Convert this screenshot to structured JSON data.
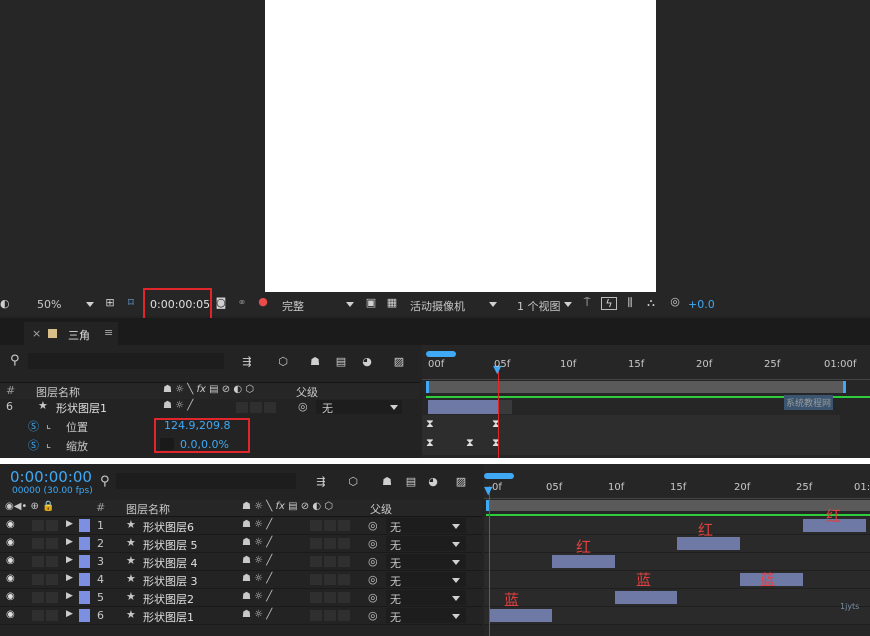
{
  "viewer": {
    "zoom": "50%",
    "timecode": "0:00:00:05",
    "resolution": "完整",
    "camera": "活动摄像机",
    "views": "1 个视图",
    "exposure": "+0.0"
  },
  "top_panel": {
    "close": "×",
    "tab_title": "三角",
    "menu": "≡",
    "search_icon": "⚲",
    "col_num": "#",
    "col_name": "图层名称",
    "col_parent": "父级",
    "layer_num": "6",
    "layer_name": "形状图层1",
    "parent_value": "无",
    "prop_position_label": "位置",
    "prop_position_value": "124.9,209.8",
    "prop_scale_label": "缩放",
    "prop_scale_value": "0.0,0.0%",
    "ruler": [
      "00f",
      "05f",
      "10f",
      "15f",
      "20f",
      "25f",
      "01:00f"
    ],
    "watermark": "系统教程网"
  },
  "bottom_panel": {
    "timecode": "0:00:00:00",
    "fps": "00000 (30.00 fps)",
    "col_num": "#",
    "col_name": "图层名称",
    "col_parent": "父级",
    "ruler": [
      "0f",
      "05f",
      "10f",
      "15f",
      "20f",
      "25f",
      "01:0"
    ],
    "layers": [
      {
        "num": "1",
        "name": "形状图层6",
        "parent": "无"
      },
      {
        "num": "2",
        "name": "形状图层 5",
        "parent": "无"
      },
      {
        "num": "3",
        "name": "形状图层 4",
        "parent": "无"
      },
      {
        "num": "4",
        "name": "形状图层 3",
        "parent": "无"
      },
      {
        "num": "5",
        "name": "形状图层2",
        "parent": "无"
      },
      {
        "num": "6",
        "name": "形状图层1",
        "parent": "无"
      }
    ],
    "annotations": [
      "红",
      "红",
      "红",
      "蓝",
      "蓝",
      "蓝"
    ],
    "corner_text": "1jyts"
  },
  "colors": {
    "accent_blue": "#3fa9f5",
    "red_highlight": "#e0262b",
    "layer_bar": "#6e79a6",
    "work_area_green": "#2fcc3e"
  }
}
